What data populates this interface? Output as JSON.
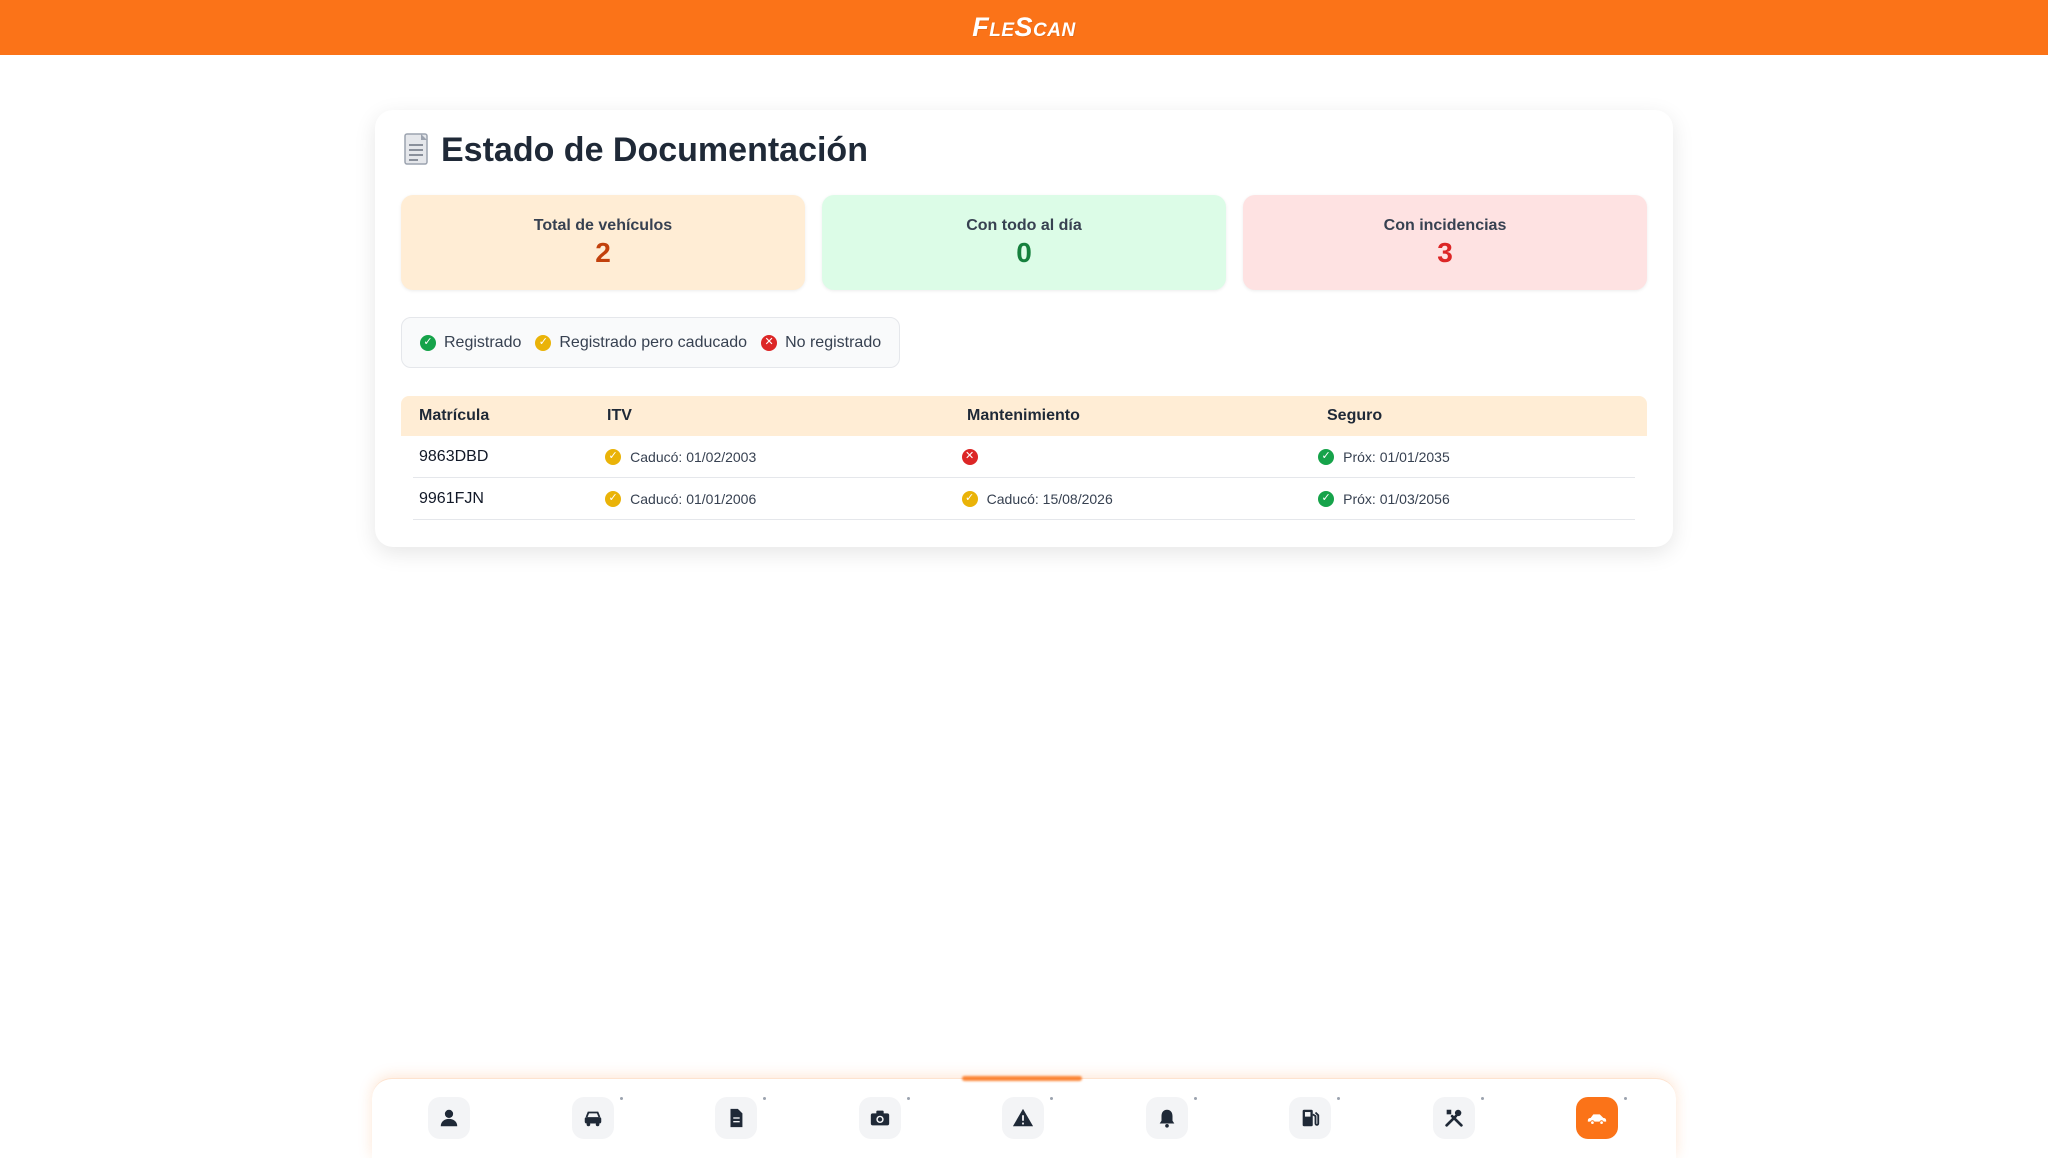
{
  "header": {
    "logo": "FleScan"
  },
  "page": {
    "title": "Estado de Documentación"
  },
  "stats": [
    {
      "label": "Total de vehículos",
      "value": "2"
    },
    {
      "label": "Con todo al día",
      "value": "0"
    },
    {
      "label": "Con incidencias",
      "value": "3"
    }
  ],
  "legend": {
    "registered": "Registrado",
    "expired": "Registrado pero caducado",
    "missing": "No registrado"
  },
  "table": {
    "headers": {
      "plate": "Matrícula",
      "itv": "ITV",
      "maintenance": "Mantenimiento",
      "insurance": "Seguro"
    },
    "rows": [
      {
        "plate": "9863DBD",
        "itv": {
          "status": "expired",
          "text": "Caducó: 01/02/2003"
        },
        "maintenance": {
          "status": "missing",
          "text": ""
        },
        "insurance": {
          "status": "registered",
          "text": "Próx: 01/01/2035"
        }
      },
      {
        "plate": "9961FJN",
        "itv": {
          "status": "expired",
          "text": "Caducó: 01/01/2006"
        },
        "maintenance": {
          "status": "expired",
          "text": "Caducó: 15/08/2026"
        },
        "insurance": {
          "status": "registered",
          "text": "Próx: 01/03/2056"
        }
      }
    ]
  },
  "colors": {
    "brand": "#fb7318",
    "ok": "#16a34a",
    "warn": "#eab308",
    "error": "#dc2626"
  },
  "nav": {
    "items": [
      {
        "icon": "user-icon",
        "active": false
      },
      {
        "icon": "car-icon",
        "active": false
      },
      {
        "icon": "document-icon",
        "active": false
      },
      {
        "icon": "camera-icon",
        "active": false
      },
      {
        "icon": "warning-icon",
        "active": false
      },
      {
        "icon": "bell-icon",
        "active": false
      },
      {
        "icon": "fuel-pump-icon",
        "active": false
      },
      {
        "icon": "tools-icon",
        "active": false
      },
      {
        "icon": "car-side-icon",
        "active": true
      }
    ]
  }
}
